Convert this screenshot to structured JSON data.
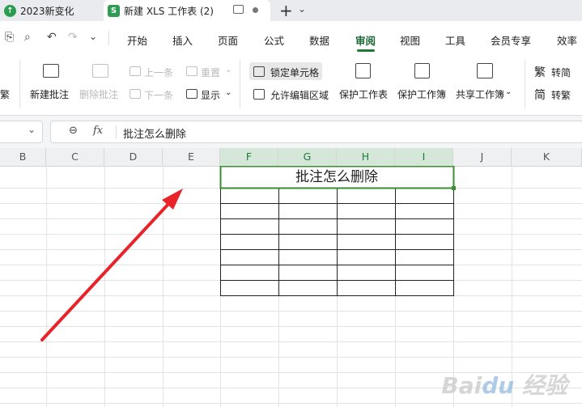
{
  "tabs": [
    {
      "label": "2023新变化",
      "icon": "upload-arrow-icon"
    },
    {
      "label": "新建 XLS 工作表 (2)",
      "icon": "spreadsheet-s-icon"
    }
  ],
  "menu": {
    "items": [
      "开始",
      "插入",
      "页面",
      "公式",
      "数据",
      "审阅",
      "视图",
      "工具",
      "会员专享",
      "效率"
    ],
    "active": "审阅"
  },
  "ribbon": {
    "new_comment": "新建批注",
    "delete_comment": "删除批注",
    "prev": "上一条",
    "next": "下一条",
    "reset": "重置",
    "show": "显示",
    "lock_cell": "锁定单元格",
    "allow_edit": "允许编辑区域",
    "protect_sheet": "保护工作表",
    "protect_book": "保护工作簿",
    "share_book": "共享工作簿",
    "to_traditional": "转简",
    "to_simplified": "转繁",
    "left_cut": "繁"
  },
  "formula_bar": {
    "fx": "fx",
    "content": "批注怎么删除"
  },
  "columns": [
    "B",
    "C",
    "D",
    "E",
    "F",
    "G",
    "H",
    "I",
    "J",
    "K"
  ],
  "merged_cell_text": "批注怎么删除",
  "watermark": "Bai du 经验",
  "colors": {
    "accent": "#1f7a3a",
    "selection_border": "#3b8c32",
    "arrow": "#e8232a"
  }
}
